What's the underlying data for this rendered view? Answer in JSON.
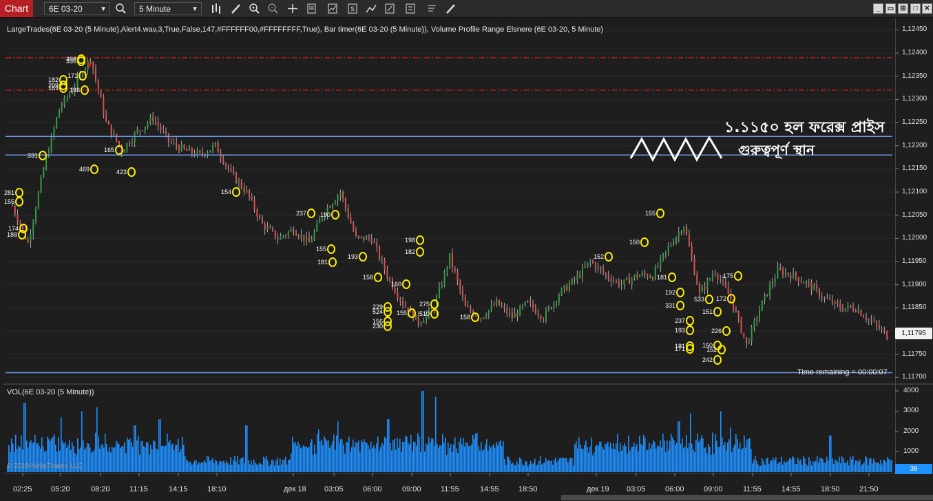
{
  "toolbar": {
    "tab_label": "Chart",
    "instrument": "6E 03-20",
    "interval": "5 Minute"
  },
  "indicator_line": "LargeTrades(6E 03-20 (5 Minute),Alert4.wav,3,True,False,147,#FFFFFF00,#FFFFFFFF,True), Bar timer(6E 03-20 (5 Minute)), Volume Profile Range Elsnere (6E 03-20, 5 Minute)",
  "volume_panel_title": "VOL(6E 03-20 (5 Minute))",
  "copyright": "© 2019 NinjaTrader, LLC",
  "time_remaining": "Time remaining = 00:00:07",
  "current_price": "1,11795",
  "current_volume": "36",
  "annotation": {
    "line1": "১.১১৫০ হল ফরেক্স প্রাইস",
    "line2": "গুরুত্বপূর্ণ স্থান"
  },
  "price_axis": [
    "1,12450",
    "1,12400",
    "1,12350",
    "1,12300",
    "1,12250",
    "1,12200",
    "1,12150",
    "1,12100",
    "1,12050",
    "1,12000",
    "1,11950",
    "1,11900",
    "1,11850",
    "1,11800",
    "1,11750",
    "1,11700"
  ],
  "volume_axis": [
    "4000",
    "3000",
    "2000",
    "1000"
  ],
  "time_axis": [
    {
      "label": "02:25",
      "x": 33
    },
    {
      "label": "05:20",
      "x": 88
    },
    {
      "label": "08:20",
      "x": 146
    },
    {
      "label": "11:15",
      "x": 202
    },
    {
      "label": "14:15",
      "x": 259
    },
    {
      "label": "18:10",
      "x": 315
    },
    {
      "label": "дек 18",
      "x": 426
    },
    {
      "label": "03:05",
      "x": 485
    },
    {
      "label": "06:00",
      "x": 541
    },
    {
      "label": "09:00",
      "x": 598
    },
    {
      "label": "11:55",
      "x": 654
    },
    {
      "label": "14:55",
      "x": 711
    },
    {
      "label": "18:50",
      "x": 767
    },
    {
      "label": "дек 19",
      "x": 866
    },
    {
      "label": "03:05",
      "x": 924
    },
    {
      "label": "06:00",
      "x": 980
    },
    {
      "label": "09:00",
      "x": 1036
    },
    {
      "label": "11:55",
      "x": 1093
    },
    {
      "label": "14:55",
      "x": 1149
    },
    {
      "label": "18:50",
      "x": 1206
    },
    {
      "label": "21:50",
      "x": 1262
    }
  ],
  "chart_data": {
    "type": "candlestick",
    "symbol": "6E 03-20",
    "interval": "5 Minute",
    "y_range": [
      1.1169,
      1.1247
    ],
    "support_resistance_lines": [
      1.1222,
      1.1218,
      1.1171
    ],
    "dashed_red_lines": [
      1.1239,
      1.1232
    ],
    "close_path": [
      [
        0,
        1.1207
      ],
      [
        6,
        1.1199
      ],
      [
        12,
        1.1215
      ],
      [
        18,
        1.1228
      ],
      [
        24,
        1.1233
      ],
      [
        30,
        1.1239
      ],
      [
        36,
        1.1225
      ],
      [
        42,
        1.1219
      ],
      [
        48,
        1.1223
      ],
      [
        54,
        1.1226
      ],
      [
        60,
        1.1221
      ],
      [
        66,
        1.1219
      ],
      [
        72,
        1.1218
      ],
      [
        78,
        1.122
      ],
      [
        84,
        1.1214
      ],
      [
        90,
        1.121
      ],
      [
        96,
        1.1203
      ],
      [
        102,
        1.12
      ],
      [
        108,
        1.1202
      ],
      [
        114,
        1.1199
      ],
      [
        120,
        1.1206
      ],
      [
        126,
        1.121
      ],
      [
        132,
        1.12
      ],
      [
        138,
        1.12
      ],
      [
        144,
        1.1192
      ],
      [
        150,
        1.1186
      ],
      [
        156,
        1.1182
      ],
      [
        162,
        1.1185
      ],
      [
        168,
        1.1196
      ],
      [
        174,
        1.1185
      ],
      [
        180,
        1.1183
      ],
      [
        186,
        1.1186
      ],
      [
        192,
        1.1183
      ],
      [
        198,
        1.1186
      ],
      [
        204,
        1.1183
      ],
      [
        210,
        1.1188
      ],
      [
        216,
        1.1191
      ],
      [
        222,
        1.1195
      ],
      [
        228,
        1.1192
      ],
      [
        234,
        1.119
      ],
      [
        240,
        1.1192
      ],
      [
        246,
        1.1192
      ],
      [
        252,
        1.1198
      ],
      [
        258,
        1.1203
      ],
      [
        264,
        1.1188
      ],
      [
        270,
        1.1193
      ],
      [
        276,
        1.1187
      ],
      [
        282,
        1.1177
      ],
      [
        288,
        1.1186
      ],
      [
        294,
        1.1193
      ],
      [
        300,
        1.1192
      ],
      [
        306,
        1.119
      ],
      [
        312,
        1.1187
      ],
      [
        318,
        1.1185
      ],
      [
        324,
        1.1185
      ],
      [
        330,
        1.1182
      ],
      [
        336,
        1.1179
      ]
    ],
    "large_trades": [
      {
        "label": "281",
        "series": "A"
      },
      {
        "label": "155",
        "series": "A"
      },
      {
        "label": "174",
        "series": "A"
      },
      {
        "label": "188",
        "series": "A"
      },
      {
        "label": "331",
        "series": "A"
      },
      {
        "label": "182",
        "series": "A"
      },
      {
        "label": "209",
        "series": "A"
      },
      {
        "label": "169",
        "series": "A"
      },
      {
        "label": "298",
        "series": "A"
      },
      {
        "label": "336",
        "series": "A"
      },
      {
        "label": "171",
        "series": "A"
      },
      {
        "label": "193",
        "series": "A"
      },
      {
        "label": "469",
        "series": "A"
      },
      {
        "label": "165",
        "series": "A"
      },
      {
        "label": "423",
        "series": "A"
      },
      {
        "label": "154",
        "series": "A"
      },
      {
        "label": "237",
        "series": "A"
      },
      {
        "label": "190",
        "series": "A"
      },
      {
        "label": "155",
        "series": "A"
      },
      {
        "label": "181",
        "series": "A"
      },
      {
        "label": "193",
        "series": "A"
      },
      {
        "label": "158",
        "series": "A"
      },
      {
        "label": "160",
        "series": "A"
      },
      {
        "label": "229",
        "series": "A"
      },
      {
        "label": "524",
        "series": "A"
      },
      {
        "label": "156",
        "series": "A"
      },
      {
        "label": "230",
        "series": "A"
      },
      {
        "label": "198",
        "series": "A"
      },
      {
        "label": "182",
        "series": "A"
      },
      {
        "label": "275",
        "series": "A"
      },
      {
        "label": "510",
        "series": "A"
      },
      {
        "label": "155",
        "series": "A"
      },
      {
        "label": "158",
        "series": "A"
      },
      {
        "label": "152",
        "series": "A"
      },
      {
        "label": "150",
        "series": "A"
      },
      {
        "label": "155",
        "series": "A"
      },
      {
        "label": "181",
        "series": "A"
      },
      {
        "label": "192",
        "series": "A"
      },
      {
        "label": "331",
        "series": "A"
      },
      {
        "label": "237",
        "series": "A"
      },
      {
        "label": "193",
        "series": "A"
      },
      {
        "label": "181",
        "series": "A"
      },
      {
        "label": "171",
        "series": "A"
      },
      {
        "label": "150",
        "series": "A"
      },
      {
        "label": "152",
        "series": "A"
      },
      {
        "label": "242",
        "series": "A"
      },
      {
        "label": "226",
        "series": "A"
      },
      {
        "label": "151",
        "series": "A"
      },
      {
        "label": "172",
        "series": "A"
      },
      {
        "label": "533",
        "series": "A"
      },
      {
        "label": "175",
        "series": "A"
      }
    ],
    "volume_y_range": [
      0,
      4200
    ]
  }
}
